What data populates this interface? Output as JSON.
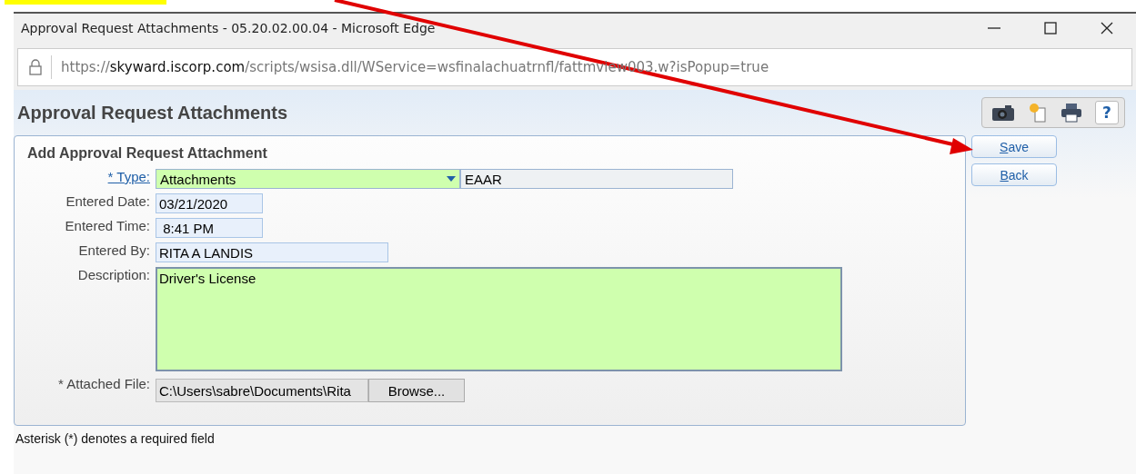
{
  "window": {
    "title": "Approval Request Attachments - 05.20.02.00.04 - Microsoft Edge"
  },
  "address_bar": {
    "scheme": "https://",
    "host": "skyward.iscorp.com",
    "path": "/scripts/wsisa.dll/WService=wsfinalachuatrnfl/fattmview003.w?isPopup=true"
  },
  "page": {
    "title": "Approval Request Attachments",
    "help": "?"
  },
  "form": {
    "title": "Add Approval Request Attachment",
    "fields": [
      {
        "kind": "dropdown",
        "label": "* Type:",
        "link": true,
        "value": "Attachments",
        "code": "EAAR"
      },
      {
        "kind": "short-text",
        "label": "Entered Date:",
        "value": "03/21/2020"
      },
      {
        "kind": "short-text",
        "label": "Entered Time:",
        "value": " 8:41 PM"
      },
      {
        "kind": "medium-text",
        "label": "Entered By:",
        "value": "RITA A LANDIS"
      },
      {
        "kind": "textarea",
        "label": "Description:",
        "value": "Driver's License"
      },
      {
        "kind": "file",
        "label": "* Attached File:",
        "value": "C:\\Users\\sabre\\Documents\\Rita",
        "button": "Browse..."
      }
    ]
  },
  "buttons": [
    {
      "key": "S",
      "rest": "ave"
    },
    {
      "key": "B",
      "rest": "ack"
    }
  ],
  "footer": "Asterisk (*) denotes a required field",
  "annotation": {
    "kind": "arrow"
  }
}
